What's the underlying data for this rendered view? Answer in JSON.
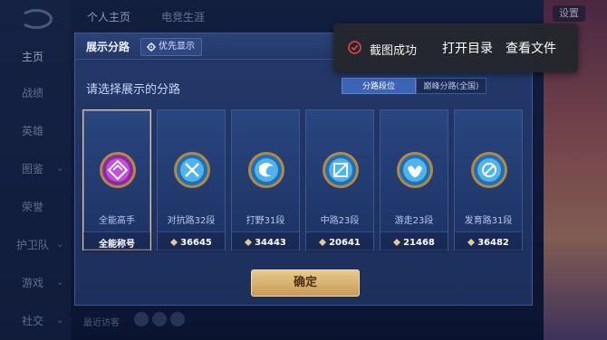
{
  "background": {
    "top_tabs": [
      "个人主页",
      "电竞生涯"
    ],
    "sidebar": [
      {
        "label": "主页",
        "active": true
      },
      {
        "label": "战绩"
      },
      {
        "label": "英雄"
      },
      {
        "label": "图鉴"
      },
      {
        "label": "荣誉"
      },
      {
        "label": "护卫队"
      },
      {
        "label": "游戏"
      },
      {
        "label": "社交"
      }
    ],
    "settings_label": "设置",
    "bottom_hint": "最近访客"
  },
  "modal": {
    "title": "展示分路",
    "priority_label": "优先显示",
    "subtitle": "请选择展示的分路",
    "segments": [
      "分路段位",
      "巅峰分路(全国)"
    ],
    "confirm_label": "确定",
    "cards": [
      {
        "name": "全能高手",
        "value": "全能称号",
        "icon": "all-round-emblem",
        "selected": true
      },
      {
        "name": "对抗路32段",
        "value": "36645",
        "icon": "clash-lane-emblem"
      },
      {
        "name": "打野31段",
        "value": "34443",
        "icon": "jungle-emblem"
      },
      {
        "name": "中路23段",
        "value": "20641",
        "icon": "mid-lane-emblem"
      },
      {
        "name": "游走23段",
        "value": "21468",
        "icon": "roam-emblem"
      },
      {
        "name": "发育路31段",
        "value": "36482",
        "icon": "farm-lane-emblem"
      }
    ]
  },
  "toast": {
    "message": "截图成功",
    "open_dir": "打开目录",
    "view_file": "查看文件"
  },
  "colors": {
    "gold": "#e2c7a0",
    "accent_blue": "#3d63b5",
    "toast_red": "#e94545"
  }
}
